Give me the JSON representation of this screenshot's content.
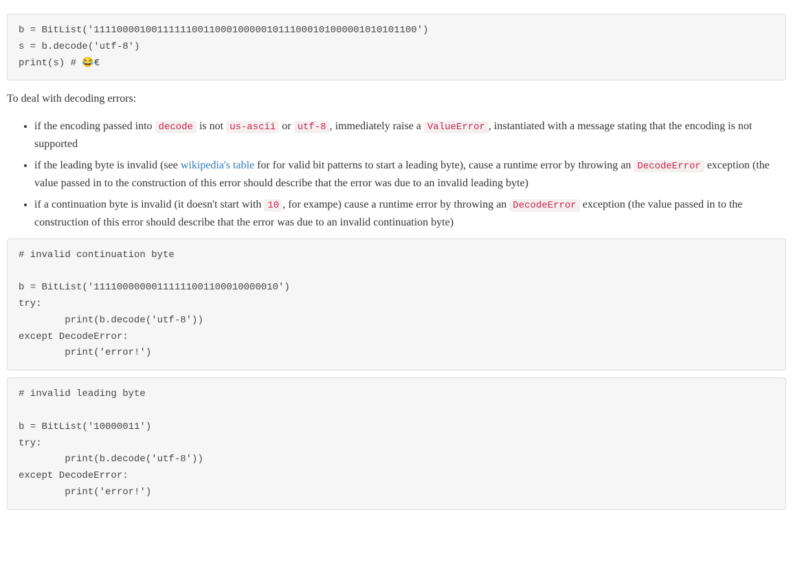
{
  "code_block_1": "b = BitList('11110000100111111001100010000010111000101000001010101100')\ns = b.decode('utf-8')\nprint(s) # 😂€",
  "intro_para": "To deal with decoding errors:",
  "bullets": {
    "b1": {
      "t1": "if the encoding passed into ",
      "c1": "decode",
      "t2": " is not ",
      "c2": "us-ascii",
      "t3": " or ",
      "c3": "utf-8",
      "t4": ", immediately raise a ",
      "c4": "ValueError",
      "t5": ", instantiated with a message stating that the encoding is not supported"
    },
    "b2": {
      "t1": "if the leading byte is invalid (see ",
      "link": "wikipedia's table",
      "t2": " for for valid bit patterns to start a leading byte), cause a runtime error by throwing an ",
      "c1": "DecodeError",
      "t3": " exception (the value passed in to the construction of this error should describe that the error was due to an invalid leading byte)"
    },
    "b3": {
      "t1": "if a continuation byte is invalid (it doesn't start with ",
      "c1": "10",
      "t2": ", for exampe) cause a runtime error by throwing an ",
      "c2": "DecodeError",
      "t3": " exception (the value passed in to the construction of this error should describe that the error was due to an invalid continuation byte)"
    }
  },
  "code_block_2": "# invalid continuation byte\n\nb = BitList('11110000000111111001100010000010')\ntry:\n        print(b.decode('utf-8'))\nexcept DecodeError:\n        print('error!')",
  "code_block_3": "# invalid leading byte\n\nb = BitList('10000011')\ntry:\n        print(b.decode('utf-8'))\nexcept DecodeError:\n        print('error!')"
}
